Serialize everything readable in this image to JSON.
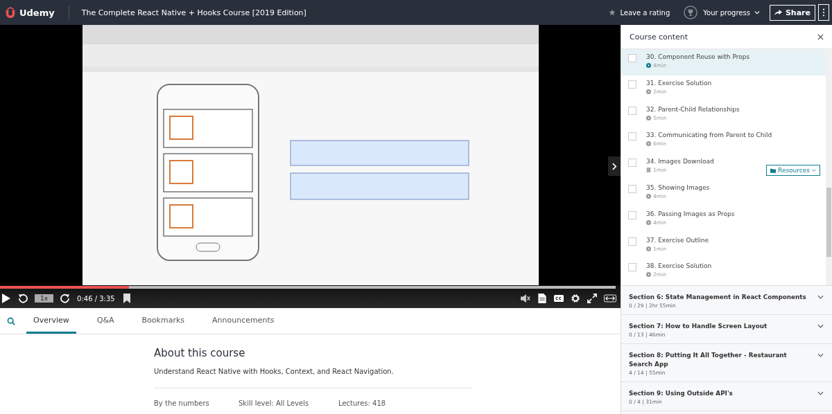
{
  "header": {
    "logo": "Udemy",
    "title": "The Complete React Native + Hooks Course [2019 Edition]",
    "rating": "Leave a rating",
    "progress": "Your progress",
    "share": "Share"
  },
  "player": {
    "progress": {
      "level": 0.21
    },
    "speed": "1x",
    "time": "0:46 / 3:35"
  },
  "tabs": [
    {
      "label": "Overview",
      "selected": true
    },
    {
      "label": "Q&A",
      "selected": false
    },
    {
      "label": "Bookmarks",
      "selected": false
    },
    {
      "label": "Announcements",
      "selected": false
    }
  ],
  "about": {
    "title": "About this course",
    "description": "Understand React Native with Hooks, Context, and React Navigation.",
    "stats": [
      "By the numbers",
      "Skill level: All Levels",
      "Lectures: 418"
    ]
  },
  "sidebar": {
    "title": "Course content",
    "lectures": [
      {
        "title": "30. Component Reuse with Props",
        "duration": "4min",
        "kind": "video",
        "selected": true,
        "checked": false
      },
      {
        "title": "31. Exercise Solution",
        "duration": "2min",
        "kind": "video",
        "selected": false,
        "checked": false
      },
      {
        "title": "32. Parent-Child Relationships",
        "duration": "5min",
        "kind": "video",
        "selected": false,
        "checked": false
      },
      {
        "title": "33. Communicating from Parent to Child",
        "duration": "6min",
        "kind": "video",
        "selected": false,
        "checked": false
      },
      {
        "title": "34. Images Download",
        "duration": "1min",
        "kind": "file",
        "selected": false,
        "checked": false,
        "resources": "Resources"
      },
      {
        "title": "35. Showing Images",
        "duration": "4min",
        "kind": "video",
        "selected": false,
        "checked": false
      },
      {
        "title": "36. Passing Images as Props",
        "duration": "4min",
        "kind": "video",
        "selected": false,
        "checked": false
      },
      {
        "title": "37. Exercise Outline",
        "duration": "1min",
        "kind": "video",
        "selected": false,
        "checked": false
      },
      {
        "title": "38. Exercise Solution",
        "duration": "2min",
        "kind": "video",
        "selected": false,
        "checked": false
      }
    ],
    "sections": [
      {
        "title": "Section 6: State Management in React Components",
        "meta": "0 / 29 | 2hr 55min"
      },
      {
        "title": "Section 7: How to Handle Screen Layout",
        "meta": "0 / 13 | 46min"
      },
      {
        "title": "Section 8: Putting It All Together - Restaurant Search App",
        "meta": "4 / 14 | 55min"
      },
      {
        "title": "Section 9: Using Outside API's",
        "meta": "0 / 4 | 31min"
      }
    ]
  }
}
